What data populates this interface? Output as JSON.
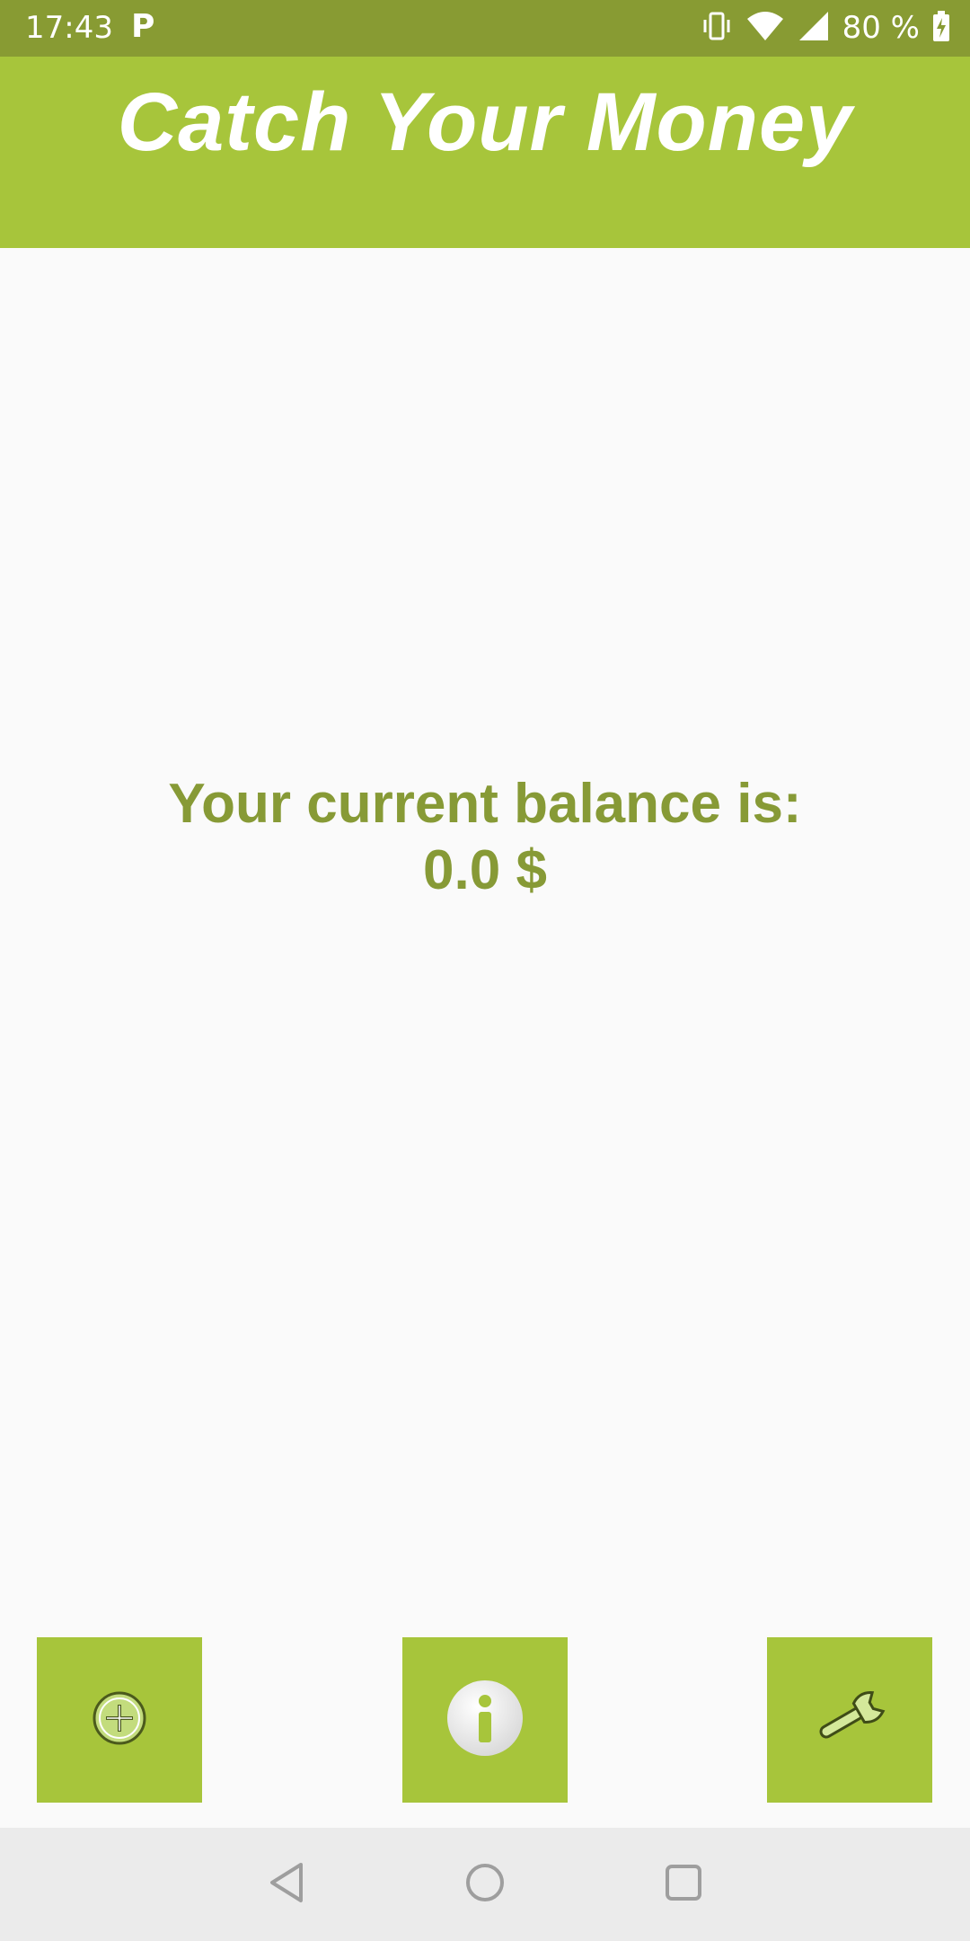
{
  "status_bar": {
    "time": "17:43",
    "notification_letter": "P",
    "battery_text": "80 %",
    "icons": [
      "vibrate-icon",
      "wifi-icon",
      "signal-icon",
      "battery-charging-icon"
    ]
  },
  "app_bar": {
    "title": "Catch Your Money"
  },
  "balance": {
    "label": "Your current balance is:",
    "value": "0.0 $"
  },
  "actions": {
    "add_icon": "add-circle-icon",
    "info_icon": "info-icon",
    "settings_icon": "wrench-icon"
  },
  "nav_bar": {
    "icons": [
      "back-icon",
      "home-icon",
      "recents-icon"
    ]
  },
  "colors": {
    "status_bar": "#889b33",
    "app_bar": "#a7c53b",
    "button": "#a7c53b",
    "balance_text": "#879a36",
    "background": "#fafafa",
    "nav_bar": "#ebebeb"
  }
}
